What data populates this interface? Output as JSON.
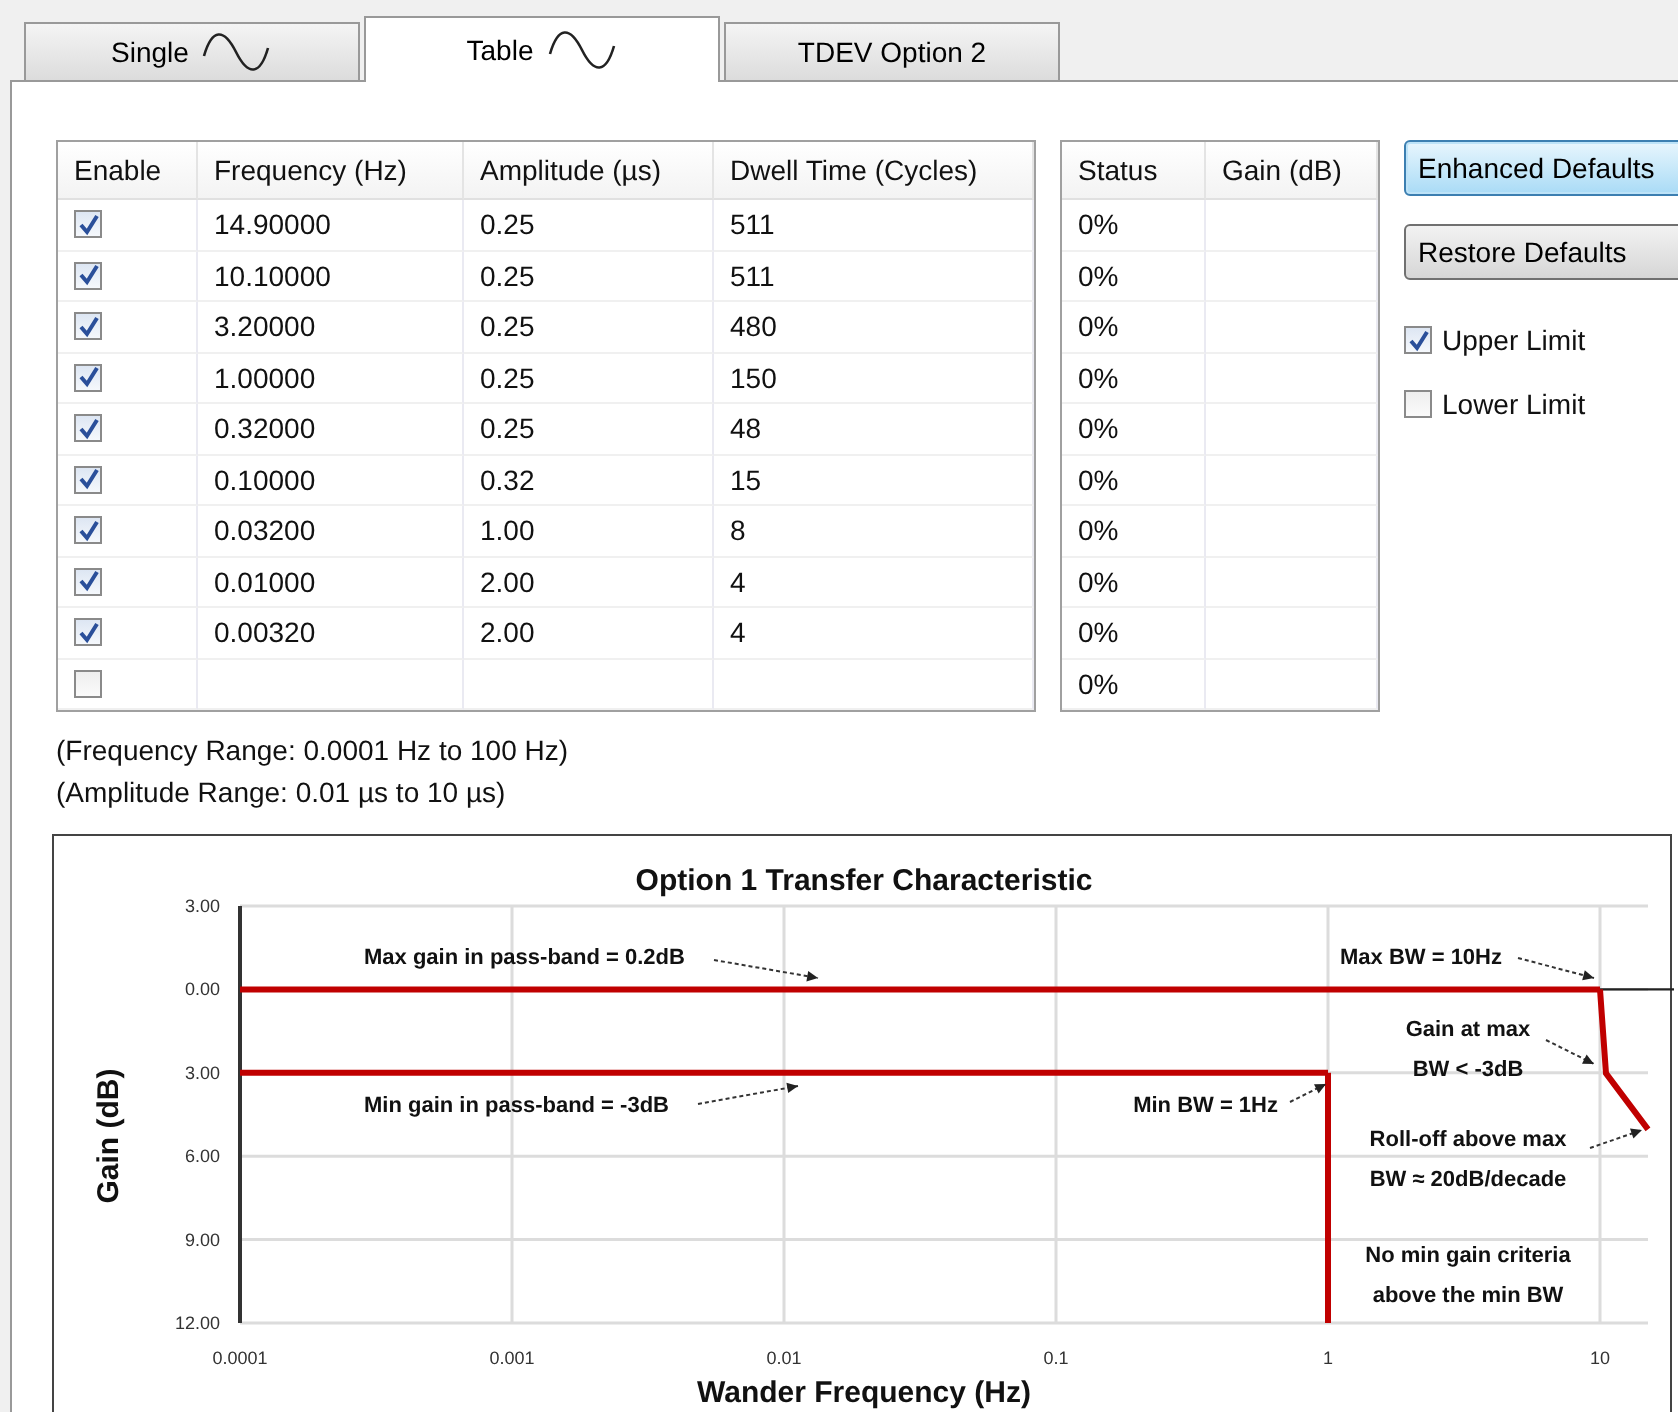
{
  "tabs": [
    {
      "label": "Single",
      "kind": "wave",
      "selected": false
    },
    {
      "label": "Table",
      "kind": "wave",
      "selected": true
    },
    {
      "label": "TDEV Option 2",
      "kind": "plain",
      "selected": false
    }
  ],
  "table": {
    "columns": [
      "Enable",
      "Frequency (Hz)",
      "Amplitude (µs)",
      "Dwell Time (Cycles)"
    ],
    "rows": [
      {
        "enabled": true,
        "frequency": "14.90000",
        "amplitude": "0.25",
        "dwell": "511"
      },
      {
        "enabled": true,
        "frequency": "10.10000",
        "amplitude": "0.25",
        "dwell": "511"
      },
      {
        "enabled": true,
        "frequency": "3.20000",
        "amplitude": "0.25",
        "dwell": "480"
      },
      {
        "enabled": true,
        "frequency": "1.00000",
        "amplitude": "0.25",
        "dwell": "150"
      },
      {
        "enabled": true,
        "frequency": "0.32000",
        "amplitude": "0.25",
        "dwell": "48"
      },
      {
        "enabled": true,
        "frequency": "0.10000",
        "amplitude": "0.32",
        "dwell": "15"
      },
      {
        "enabled": true,
        "frequency": "0.03200",
        "amplitude": "1.00",
        "dwell": "8"
      },
      {
        "enabled": true,
        "frequency": "0.01000",
        "amplitude": "2.00",
        "dwell": "4"
      },
      {
        "enabled": true,
        "frequency": "0.00320",
        "amplitude": "2.00",
        "dwell": "4"
      },
      {
        "enabled": false
      }
    ]
  },
  "status_table": {
    "columns": [
      "Status",
      "Gain (dB)"
    ],
    "rows": [
      {
        "status": "0%"
      },
      {
        "status": "0%"
      },
      {
        "status": "0%"
      },
      {
        "status": "0%"
      },
      {
        "status": "0%"
      },
      {
        "status": "0%"
      },
      {
        "status": "0%"
      },
      {
        "status": "0%"
      },
      {
        "status": "0%"
      },
      {
        "status": "0%"
      }
    ]
  },
  "buttons": [
    {
      "label": "Enhanced Defaults",
      "focused": true
    },
    {
      "label": "Restore Defaults",
      "focused": false
    }
  ],
  "options": [
    {
      "label": "Upper Limit",
      "checked": true
    },
    {
      "label": "Lower Limit",
      "checked": false
    }
  ],
  "notes": [
    "(Frequency Range: 0.0001 Hz to 100 Hz)",
    "(Amplitude Range: 0.01 µs to 10 µs)"
  ],
  "chart": {
    "chart_data": {
      "type": "line",
      "title": "Option 1 Transfer Characteristic",
      "xlabel": "Wander Frequency (Hz)",
      "ylabel": "Gain (dB)",
      "ylim": [
        -12,
        3
      ],
      "grid": true,
      "ref_lines": [
        {
          "axis": "x",
          "value": "1",
          "color": "#c00000"
        }
      ],
      "categories": [
        "0.0001",
        "0.001",
        "0.01",
        "0.1",
        "1",
        "10"
      ],
      "yticks": [
        {
          "value": 3,
          "label": "3.00"
        },
        {
          "value": 0,
          "label": "0.00"
        },
        {
          "value": -3,
          "label": "3.00"
        },
        {
          "value": -6,
          "label": "6.00"
        },
        {
          "value": -9,
          "label": "9.00"
        },
        {
          "value": -12,
          "label": "12.00"
        }
      ],
      "series": [
        {
          "color": "#c00000",
          "values": [
            0,
            0,
            0,
            0,
            0,
            0
          ]
        },
        {
          "color": "#c00000",
          "values": [
            -3,
            -3,
            -3,
            -3,
            -3,
            null
          ]
        }
      ],
      "annotations": [
        "Max gain in pass-band  = 0.2dB",
        "Min gain in pass-band  = -3dB",
        "Max BW = 10Hz",
        "Gain at max",
        "BW < -3dB",
        "Min BW = 1Hz",
        "Roll-off above max",
        "BW ≈ 20dB/decade",
        "No min gain criteria",
        "above the min BW"
      ]
    }
  }
}
